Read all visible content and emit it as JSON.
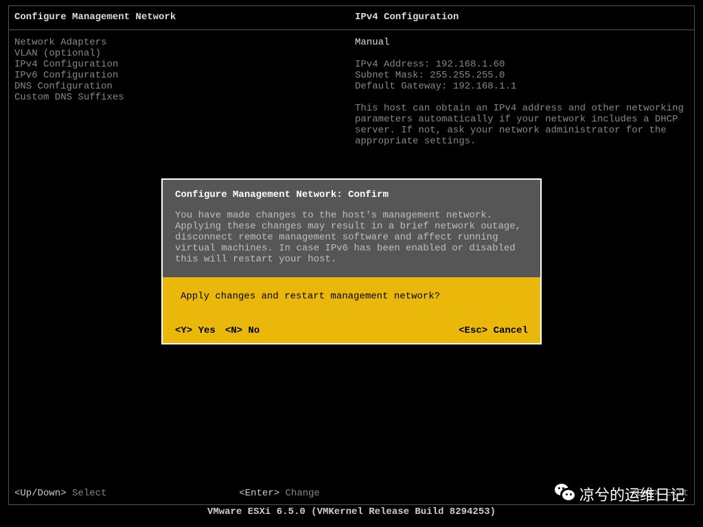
{
  "header": {
    "left_title": "Configure Management Network",
    "right_title": "IPv4 Configuration"
  },
  "menu": {
    "items": [
      "Network Adapters",
      "VLAN (optional)",
      "",
      "IPv4 Configuration",
      "IPv6 Configuration",
      "DNS Configuration",
      "Custom DNS Suffixes"
    ]
  },
  "detail": {
    "mode": "Manual",
    "ipv4_address_label": "IPv4 Address:",
    "ipv4_address_value": "192.168.1.60",
    "subnet_mask_label": "Subnet Mask:",
    "subnet_mask_value": "255.255.255.0",
    "gateway_label": "Default Gateway:",
    "gateway_value": "192.168.1.1",
    "description": "This host can obtain an IPv4 address and other networking parameters automatically if your network includes a DHCP server. If not, ask your network administrator for the appropriate settings."
  },
  "dialog": {
    "title": "Configure Management Network: Confirm",
    "body": "You have made changes to the host's management network.\nApplying these changes may result in a brief network outage, disconnect remote management software and affect running virtual machines. In case IPv6 has been enabled or disabled this will restart your host.",
    "question": "Apply changes and restart management network?",
    "yes_key": "<Y>",
    "yes_label": "Yes",
    "no_key": "<N>",
    "no_label": "No",
    "cancel_key": "<Esc>",
    "cancel_label": "Cancel"
  },
  "footer": {
    "left_key": "<Up/Down>",
    "left_label": "Select",
    "mid_key": "<Enter>",
    "mid_label": "Change",
    "right_key": "<Esc>",
    "right_label": "Exit"
  },
  "bottom_bar": "VMware ESXi 6.5.0 (VMKernel Release Build 8294253)",
  "watermark": "凉兮的运维日记"
}
